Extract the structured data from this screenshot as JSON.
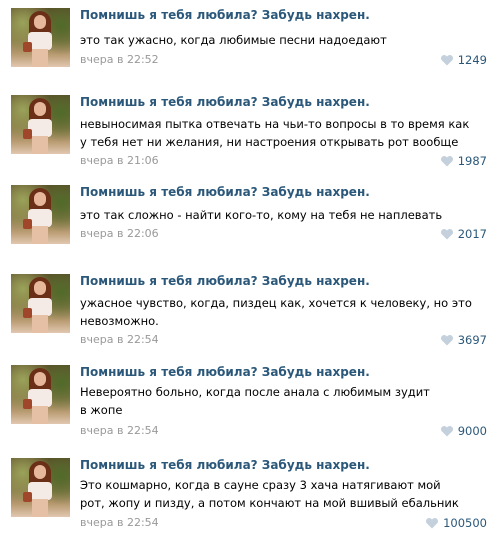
{
  "posts": [
    {
      "author": "Помнишь я тебя любила? Забудь нахрен.",
      "text": "это так ужасно, когда любимые песни надоедают",
      "time": "вчера в 22:52",
      "likes": "1249"
    },
    {
      "author": "Помнишь я тебя любила? Забудь нахрен.",
      "text": "невыносимая пытка отвечать на чьи-то вопросы в то время как\nу тебя нет ни желания, ни настроения открывать рот вообще",
      "time": "вчера в 21:06",
      "likes": "1987"
    },
    {
      "author": "Помнишь я тебя любила? Забудь нахрен.",
      "text": "это так сложно - найти кого-то, кому на тебя не наплевать",
      "time": "вчера в 22:06",
      "likes": "2017"
    },
    {
      "author": "Помнишь я тебя любила? Забудь нахрен.",
      "text": "ужасное чувство, когда, пиздец как, хочется к человеку, но это\nневозможно.",
      "time": "вчера в 22:54",
      "likes": "3697"
    },
    {
      "author": "Помнишь я тебя любила? Забудь нахрен.",
      "text": "Невероятно больно, когда после анала с любимым зудит\nв жопе",
      "time": "вчера в 22:54",
      "likes": "9000"
    },
    {
      "author": "Помнишь я тебя любила? Забудь нахрен.",
      "text": "Это кошмарно, когда в сауне сразу 3 хача натягивают мой\nрот, жопу и пизду, а потом кончают на мой вшивый ебальник",
      "time": "вчера в 22:54",
      "likes": "100500"
    }
  ],
  "icons": {
    "like": "heart-icon"
  },
  "colors": {
    "author": "#2b587a",
    "time": "#999999",
    "heart": "#c4d1dd"
  }
}
